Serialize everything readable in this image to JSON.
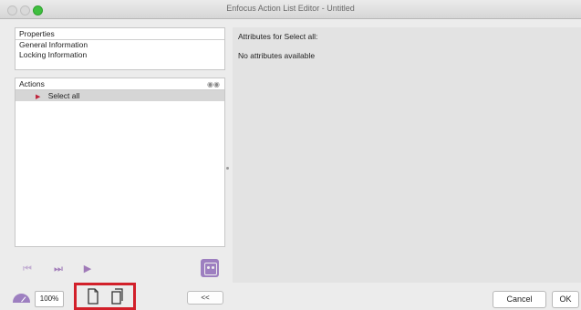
{
  "window": {
    "title": "Enfocus Action List Editor - Untitled"
  },
  "properties": {
    "header": "Properties",
    "items": [
      "General Information",
      "Locking Information"
    ]
  },
  "actions": {
    "header": "Actions",
    "items": [
      "Select all"
    ]
  },
  "attributes": {
    "header": "Attributes for Select all:",
    "empty_message": "No attributes available"
  },
  "toolbar": {
    "zoom": "100%",
    "collapse_label": "<<",
    "cancel_label": "Cancel",
    "ok_label": "OK",
    "icons": [
      "first-icon",
      "step-icon",
      "play-icon",
      "preview-icon",
      "gauge-icon",
      "new-document-icon",
      "duplicate-document-icon"
    ]
  },
  "colors": {
    "accent": "#9d7fc0",
    "highlight": "#d2202a",
    "marker": "#c0243c"
  }
}
